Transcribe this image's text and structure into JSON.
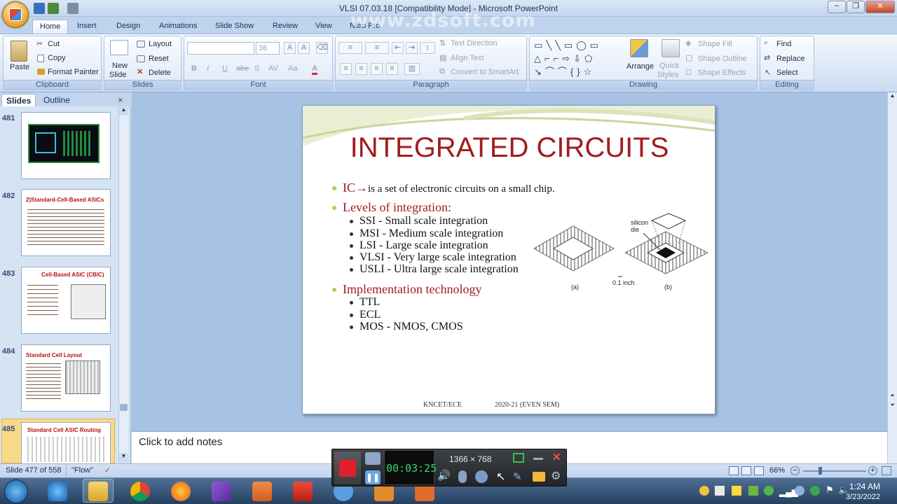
{
  "window": {
    "title": "VLSI 07.03.18 [Compatibility Mode] - Microsoft PowerPoint",
    "controls": [
      "–",
      "❐",
      "✕"
    ]
  },
  "watermark": "www.zdsoft.com",
  "tabs": [
    "Home",
    "Insert",
    "Design",
    "Animations",
    "Slide Show",
    "Review",
    "View",
    "Nitro Pro"
  ],
  "ribbon": {
    "clipboard": {
      "paste": "Paste",
      "cut": "Cut",
      "copy": "Copy",
      "format_painter": "Format Painter",
      "label": "Clipboard"
    },
    "slides": {
      "new_slide_1": "New",
      "new_slide_2": "Slide",
      "layout": "Layout",
      "reset": "Reset",
      "delete": "Delete",
      "label": "Slides"
    },
    "font": {
      "size": "36",
      "bold": "B",
      "italic": "I",
      "underline": "U",
      "strike": "abe",
      "shadow": "S",
      "spacing": "AV",
      "case": "Aa",
      "color": "A",
      "label": "Font"
    },
    "paragraph": {
      "text_direction": "Text Direction",
      "align_text": "Align Text",
      "convert": "Convert to SmartArt",
      "label": "Paragraph"
    },
    "drawing": {
      "arrange": "Arrange",
      "quick_1": "Quick",
      "quick_2": "Styles",
      "shape_fill": "Shape Fill",
      "shape_outline": "Shape Outline",
      "shape_effects": "Shape Effects",
      "label": "Drawing"
    },
    "editing": {
      "find": "Find",
      "replace": "Replace",
      "select": "Select",
      "label": "Editing"
    }
  },
  "pane": {
    "tabs": [
      "Slides",
      "Outline"
    ],
    "close": "×",
    "thumbnails": [
      {
        "number": "481",
        "title": ""
      },
      {
        "number": "482",
        "title": "2)Standard-Cell-Based ASICs"
      },
      {
        "number": "483",
        "title": "Cell-Based ASIC (CBIC)"
      },
      {
        "number": "484",
        "title": "Standard Cell Layout"
      },
      {
        "number": "485",
        "title": "Standard Cell ASIC Routing"
      }
    ]
  },
  "slide": {
    "title": "INTEGRATED CIRCUITS",
    "bullet1": {
      "lead": "IC",
      "arrow": "→",
      "rest": "is a set of electronic circuits on a small chip."
    },
    "bullet2": "Levels of integration:",
    "levels": [
      "SSI - Small scale integration",
      "MSI - Medium scale integration",
      "LSI - Large scale integration",
      "VLSI - Very large scale integration",
      "USLI - Ultra large scale integration"
    ],
    "bullet3": "Implementation technology",
    "tech": [
      "TTL",
      "ECL",
      "MOS - NMOS, CMOS"
    ],
    "figure": {
      "silicon": "silicon",
      "die": "die",
      "label_a": "(a)",
      "label_b": "(b)",
      "scale": "0.1 inch"
    },
    "footer_left": "KNCET/ECE",
    "footer_right": "2020-21 (EVEN SEM)"
  },
  "notes": {
    "placeholder": "Click to add notes"
  },
  "status": {
    "slide": "Slide 477 of 558",
    "theme": "\"Flow\"",
    "zoom": "66%"
  },
  "recorder": {
    "timer": "00:03:25",
    "resolution": "1366 × 768"
  },
  "clock": {
    "time": "1:24 AM",
    "date": "3/23/2022"
  }
}
